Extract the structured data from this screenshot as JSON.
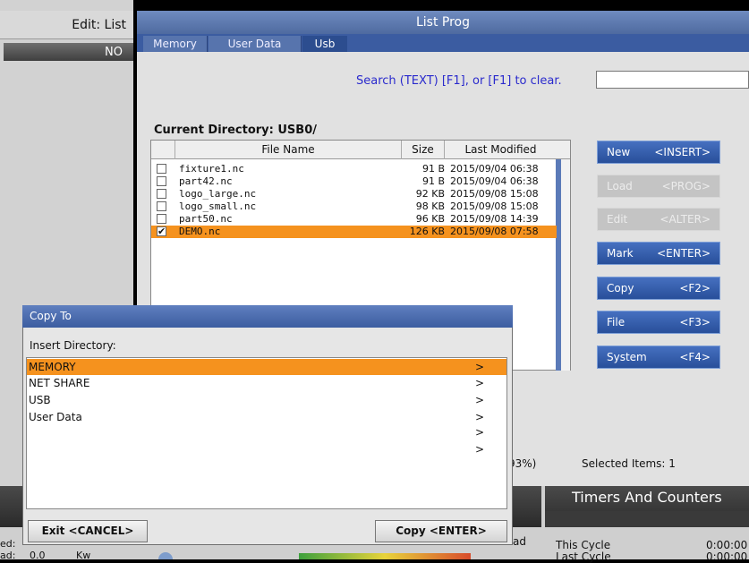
{
  "left_panel": {
    "title": "Edit: List",
    "no_label": "NO"
  },
  "window": {
    "title": "List Prog"
  },
  "tabs": [
    "Memory",
    "User Data",
    "Usb"
  ],
  "search": {
    "hint": "Search (TEXT) [F1], or [F1] to clear.",
    "value": ""
  },
  "current_directory": "Current Directory: USB0/",
  "table": {
    "columns": [
      "File Name",
      "Size",
      "Last Modified"
    ],
    "rows": [
      {
        "name": "fixture1.nc",
        "size": "91 B",
        "modified": "2015/09/04 06:38",
        "checked": "",
        "selected": false
      },
      {
        "name": "part42.nc",
        "size": "91 B",
        "modified": "2015/09/04 06:38",
        "checked": "",
        "selected": false
      },
      {
        "name": "logo_large.nc",
        "size": "92 KB",
        "modified": "2015/09/08 15:08",
        "checked": "",
        "selected": false
      },
      {
        "name": "logo_small.nc",
        "size": "98 KB",
        "modified": "2015/09/08 15:08",
        "checked": "",
        "selected": false
      },
      {
        "name": "part50.nc",
        "size": "96 KB",
        "modified": "2015/09/08 14:39",
        "checked": "",
        "selected": false
      },
      {
        "name": "DEMO.nc",
        "size": "126 KB",
        "modified": "2015/09/08 07:58",
        "checked": "✔",
        "selected": true
      }
    ]
  },
  "side_buttons": [
    {
      "label": "New",
      "key": "<INSERT>",
      "enabled": true
    },
    {
      "label": "Load",
      "key": "<PROG>",
      "enabled": false
    },
    {
      "label": "Edit",
      "key": "<ALTER>",
      "enabled": false
    },
    {
      "label": "Mark",
      "key": "<ENTER>",
      "enabled": true
    },
    {
      "label": "Copy",
      "key": "<F2>",
      "enabled": true
    },
    {
      "label": "File",
      "key": "<F3>",
      "enabled": true
    },
    {
      "label": "System",
      "key": "<F4>",
      "enabled": true
    }
  ],
  "usage_text": "93%)",
  "selected_items": "Selected Items: 1",
  "dialog": {
    "title": "Copy To",
    "prompt": "Insert Directory:",
    "items": [
      {
        "label": "MEMORY",
        "arrow": ">"
      },
      {
        "label": "NET SHARE",
        "arrow": ">"
      },
      {
        "label": "USB",
        "arrow": ">"
      },
      {
        "label": "User Data",
        "arrow": ">"
      }
    ],
    "extra_arrows": [
      ">",
      ">"
    ],
    "exit_label": "Exit <CANCEL>",
    "copy_label": "Copy <ENTER>"
  },
  "bottom": {
    "timers_title": "Timers And Counters",
    "this_cycle_label": "This Cycle",
    "this_cycle_value": "0:00:00",
    "last_cycle_label": "Last Cycle",
    "last_cycle_value": "0:00:00",
    "left_ed": "ed:",
    "left_ad": "ad:",
    "value_0": "0.0",
    "value_kw": "Kw",
    "ad_right": "ad"
  },
  "colors": {
    "accent_blue": "#3b5ca1",
    "selection_orange": "#f5921e"
  }
}
